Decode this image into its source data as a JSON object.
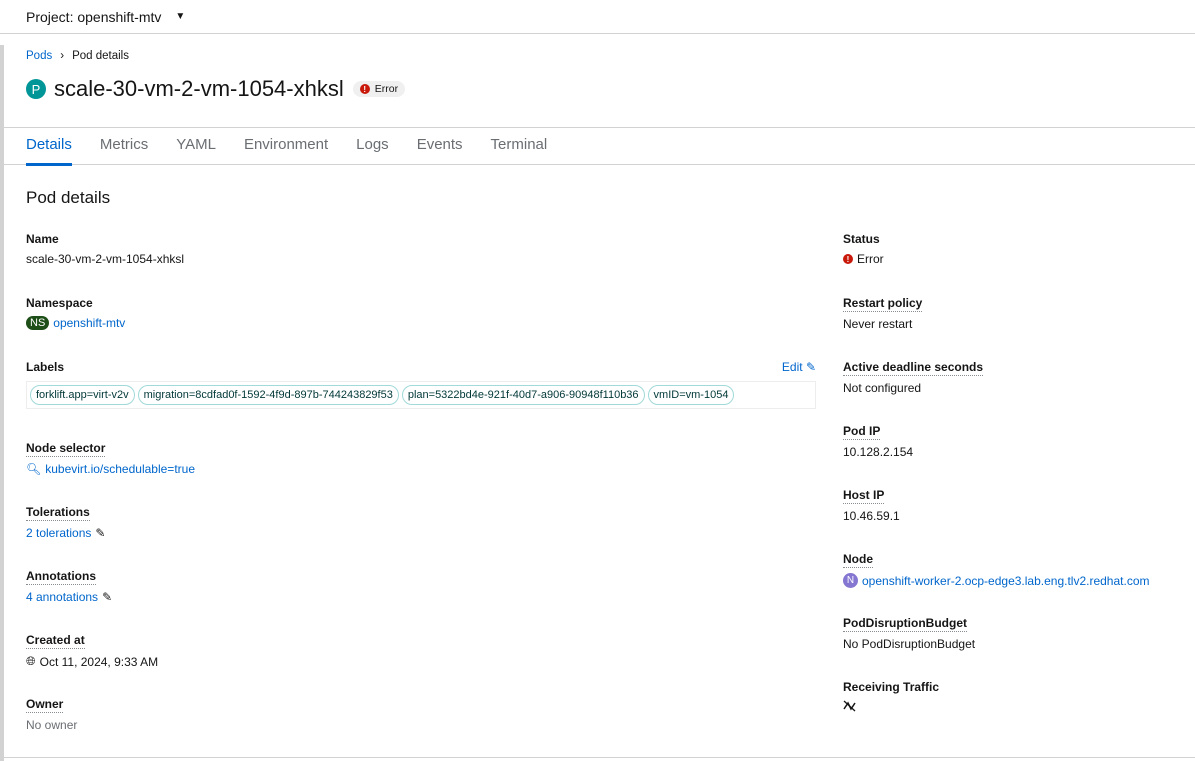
{
  "header": {
    "project": "Project: openshift-mtv"
  },
  "breadcrumb": {
    "parent": "Pods",
    "current": "Pod details"
  },
  "title": {
    "badge": "P",
    "name": "scale-30-vm-2-vm-1054-xhksl",
    "status": "Error"
  },
  "tabs": [
    "Details",
    "Metrics",
    "YAML",
    "Environment",
    "Logs",
    "Events",
    "Terminal"
  ],
  "section_title": "Pod details",
  "left": {
    "name": {
      "label": "Name",
      "value": "scale-30-vm-2-vm-1054-xhksl"
    },
    "namespace": {
      "label": "Namespace",
      "badge": "NS",
      "value": "openshift-mtv"
    },
    "labels": {
      "label": "Labels",
      "edit": "Edit",
      "items": [
        "forklift.app=virt-v2v",
        "migration=8cdfad0f-1592-4f9d-897b-744243829f53",
        "plan=5322bd4e-921f-40d7-a906-90948f110b36",
        "vmID=vm-1054"
      ]
    },
    "node_selector": {
      "label": "Node selector",
      "value": "kubevirt.io/schedulable=true"
    },
    "tolerations": {
      "label": "Tolerations",
      "value": "2 tolerations"
    },
    "annotations": {
      "label": "Annotations",
      "value": "4 annotations"
    },
    "created": {
      "label": "Created at",
      "value": "Oct 11, 2024, 9:33 AM"
    },
    "owner": {
      "label": "Owner",
      "value": "No owner"
    }
  },
  "right": {
    "status": {
      "label": "Status",
      "value": "Error"
    },
    "restart": {
      "label": "Restart policy",
      "value": "Never restart"
    },
    "deadline": {
      "label": "Active deadline seconds",
      "value": "Not configured"
    },
    "pod_ip": {
      "label": "Pod IP",
      "value": "10.128.2.154"
    },
    "host_ip": {
      "label": "Host IP",
      "value": "10.46.59.1"
    },
    "node": {
      "label": "Node",
      "badge": "N",
      "value": "openshift-worker-2.ocp-edge3.lab.eng.tlv2.redhat.com"
    },
    "pdb": {
      "label": "PodDisruptionBudget",
      "value": "No PodDisruptionBudget"
    },
    "traffic": {
      "label": "Receiving Traffic",
      "icon": "not-receiving-traffic-icon"
    }
  },
  "colors": {
    "link": "#0066cc",
    "error": "#c9190b",
    "pod_badge": "#009596",
    "ns_badge": "#1e4f18",
    "node_badge": "#8476d1"
  }
}
